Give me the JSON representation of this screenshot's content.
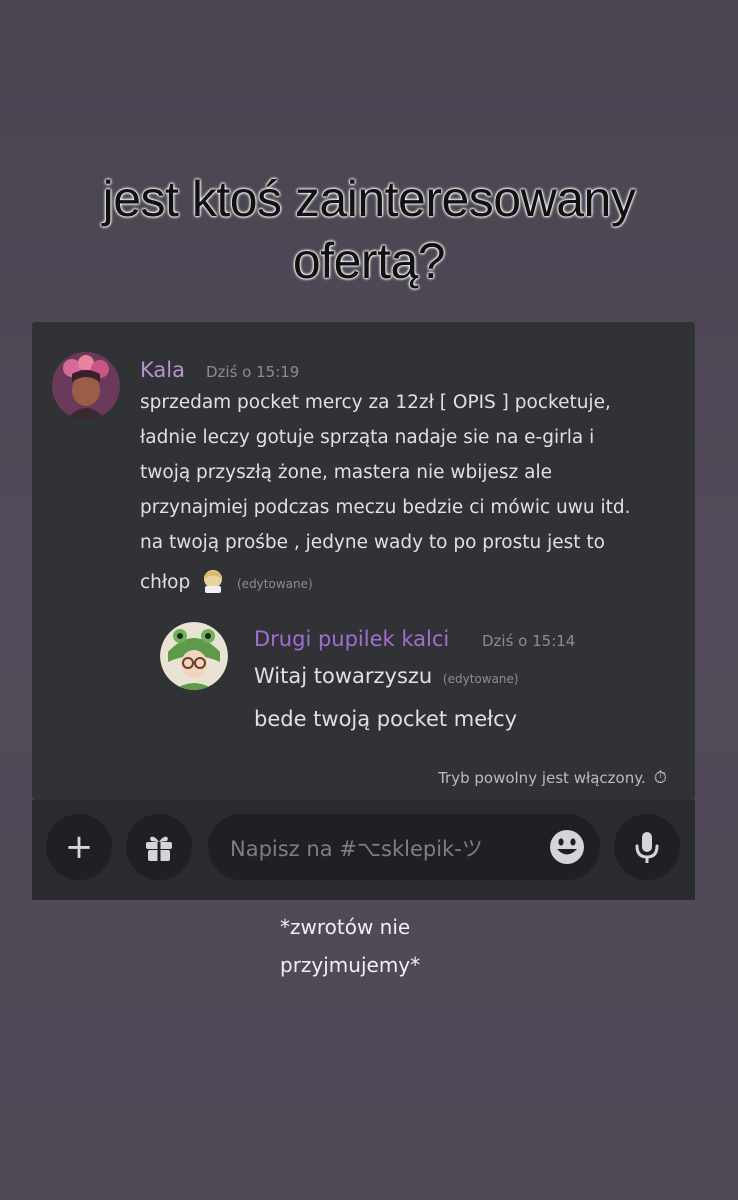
{
  "headline": {
    "line1": "jest ktoś zainteresowany",
    "line2": "ofertą?"
  },
  "messages": [
    {
      "author": "Kala",
      "time": "Dziś o 15:19",
      "author_color": "#b892cf",
      "lines": [
        "sprzedam pocket mercy za 12zł [ OPIS ] pocketuje,",
        "ładnie leczy gotuje sprząta nadaje sie na e-girla i",
        "twoją przyszłą żone, mastera nie wbijesz ale",
        "przynajmiej podczas meczu bedzie ci mówic uwu itd.",
        "na twoją prośbe , jedyne wady to po prostu jest to",
        "chłop"
      ],
      "edited": "(edytowane)"
    },
    {
      "author": "Drugi pupilek kalci",
      "time": "Dziś o 15:14",
      "author_color": "#a26fcf",
      "lines": [
        "Witaj towarzyszu",
        "bede twoją pocket mełcy"
      ],
      "edited": "(edytowane)"
    }
  ],
  "slowmode": {
    "text": "Tryb powolny jest włączony.",
    "icon": "⏱"
  },
  "input": {
    "placeholder": "Napisz na #⌥sklepik-ツ"
  },
  "buttons": {
    "add_icon": "+",
    "gift_icon": "gift-icon",
    "emoji_icon": "emoji-icon",
    "mic_icon": "microphone-icon"
  },
  "footnote": {
    "line1": "*zwrotów nie",
    "line2": "przyjmujemy*"
  }
}
